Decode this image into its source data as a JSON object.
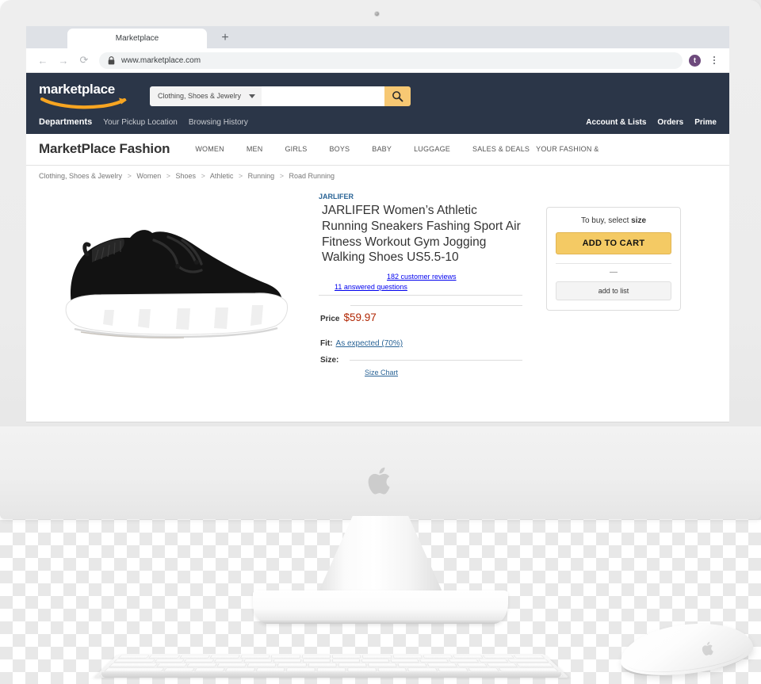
{
  "browser": {
    "tab_title": "Marketplace",
    "new_tab_label": "+",
    "back_label": "←",
    "forward_label": "→",
    "reload_label": "⟳",
    "url": "www.marketplace.com",
    "profile_initial": "t",
    "lock_icon": "lock-icon",
    "menu_icon": "kebab-menu-icon"
  },
  "site": {
    "logo_text": "marketplace",
    "search": {
      "category": "Clothing, Shoes & Jewelry",
      "value": "",
      "placeholder": "",
      "button_icon": "search-icon"
    },
    "subnav": {
      "departments": "Departments",
      "pickup": "Your Pickup Location",
      "history": "Browsing History",
      "account": "Account & Lists",
      "orders": "Orders",
      "prime": "Prime"
    },
    "fashion_nav": {
      "title": "MarketPlace Fashion",
      "links": [
        "WOMEN",
        "MEN",
        "GIRLS",
        "BOYS",
        "BABY",
        "LUGGAGE",
        "SALES & DEALS",
        "YOUR FASHION &"
      ]
    },
    "breadcrumb": [
      "Clothing, Shoes & Jewelry",
      "Women",
      "Shoes",
      "Athletic",
      "Running",
      "Road Running"
    ],
    "breadcrumb_separator": ">"
  },
  "product": {
    "brand": "JARLIFER",
    "title": "JARLIFER Women’s Athletic Running Sneakers Fashing Sport Air Fitness Workout Gym Jogging Walking Shoes US5.5-10",
    "reviews_link": "182 customer reviews",
    "questions_link": "11 answered questions",
    "price_label": "Price",
    "price_value": "$59.97",
    "fit_label": "Fit:",
    "fit_value": "As expected (70%)",
    "size_label": "Size:",
    "size_chart_link": "Size Chart",
    "image_alt": "black knit running sneaker with white sole"
  },
  "buybox": {
    "headline_prefix": "To buy, select ",
    "headline_strong": "size",
    "add_to_cart": "ADD TO CART",
    "divider": "—",
    "add_to_list": "add to list"
  },
  "device": {
    "brand_logo": "apple-logo",
    "camera": "webcam-dot",
    "keyboard": "apple-magic-keyboard",
    "mouse": "apple-magic-mouse"
  },
  "colors": {
    "header_navy": "#2b3648",
    "accent_orange": "#f7a521",
    "cart_yellow": "#f4ca64",
    "price_red": "#b12704",
    "link_blue": "#2a6496"
  }
}
